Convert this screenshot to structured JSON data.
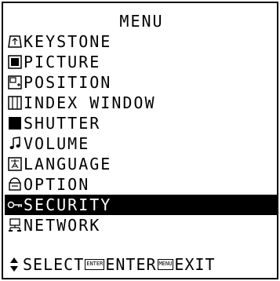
{
  "menu": {
    "title": "MENU",
    "items": [
      {
        "label": "KEYSTONE",
        "icon": "keystone-icon"
      },
      {
        "label": "PICTURE",
        "icon": "picture-icon"
      },
      {
        "label": "POSITION",
        "icon": "position-icon"
      },
      {
        "label": "INDEX WINDOW",
        "icon": "index-window-icon"
      },
      {
        "label": "SHUTTER",
        "icon": "shutter-icon"
      },
      {
        "label": "VOLUME",
        "icon": "volume-icon"
      },
      {
        "label": "LANGUAGE",
        "icon": "language-icon"
      },
      {
        "label": "OPTION",
        "icon": "option-icon"
      },
      {
        "label": "SECURITY",
        "icon": "security-icon",
        "selected": true
      },
      {
        "label": "NETWORK",
        "icon": "network-icon"
      }
    ]
  },
  "footer": {
    "select_label": "SELECT",
    "enter_key": "ENTER",
    "enter_label": "ENTER",
    "menu_key": "MENU",
    "exit_label": "EXIT"
  }
}
